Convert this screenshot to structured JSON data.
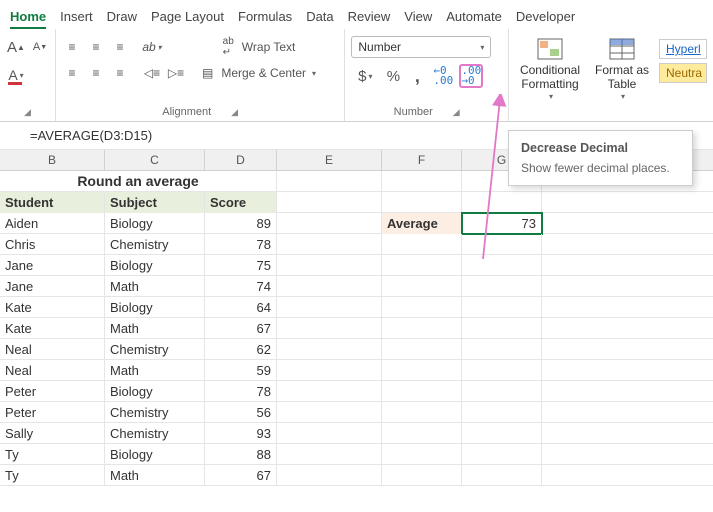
{
  "tabs": [
    "Home",
    "Insert",
    "Draw",
    "Page Layout",
    "Formulas",
    "Data",
    "Review",
    "View",
    "Automate",
    "Developer"
  ],
  "ribbon": {
    "font_launcher": "Font",
    "wrap": "Wrap Text",
    "merge": "Merge & Center",
    "alignment": "Alignment",
    "numfmt": "Number",
    "dollar": "$",
    "percent": "%",
    "comma": ",",
    "incdec": "←0\n.00",
    "decdec": ".00\n→0",
    "numgroup": "Number",
    "cond": "Conditional\nFormatting",
    "fat": "Format as\nTable",
    "style1": "Hyperl",
    "style2": "Neutra"
  },
  "tooltip": {
    "title": "Decrease Decimal",
    "body": "Show fewer decimal places."
  },
  "formula": "=AVERAGE(D3:D15)",
  "cols": [
    "B",
    "C",
    "D",
    "E",
    "F",
    "G"
  ],
  "title": "Round an average",
  "headers": {
    "B": "Student",
    "C": "Subject",
    "D": "Score"
  },
  "avg": {
    "label": "Average",
    "value": "73"
  },
  "rows": [
    {
      "b": "Aiden",
      "c": "Biology",
      "d": "89"
    },
    {
      "b": "Chris",
      "c": "Chemistry",
      "d": "78"
    },
    {
      "b": "Jane",
      "c": "Biology",
      "d": "75"
    },
    {
      "b": "Jane",
      "c": "Math",
      "d": "74"
    },
    {
      "b": "Kate",
      "c": "Biology",
      "d": "64"
    },
    {
      "b": "Kate",
      "c": "Math",
      "d": "67"
    },
    {
      "b": "Neal",
      "c": "Chemistry",
      "d": "62"
    },
    {
      "b": "Neal",
      "c": "Math",
      "d": "59"
    },
    {
      "b": "Peter",
      "c": "Biology",
      "d": "78"
    },
    {
      "b": "Peter",
      "c": "Chemistry",
      "d": "56"
    },
    {
      "b": "Sally",
      "c": "Chemistry",
      "d": "93"
    },
    {
      "b": "Ty",
      "c": "Biology",
      "d": "88"
    },
    {
      "b": "Ty",
      "c": "Math",
      "d": "67"
    }
  ]
}
